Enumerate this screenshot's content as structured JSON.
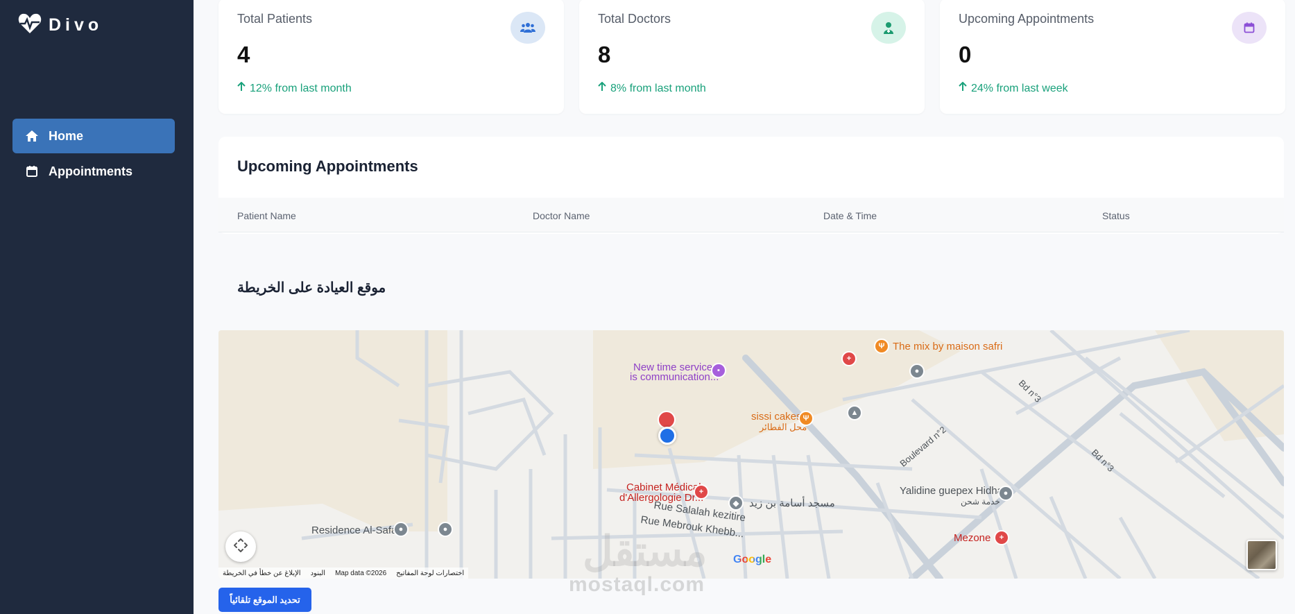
{
  "app": {
    "brand": "Divo"
  },
  "sidebar": {
    "items": [
      {
        "label": "Home",
        "icon": "home-icon",
        "active": true
      },
      {
        "label": "Appointments",
        "icon": "calendar-icon",
        "active": false
      }
    ]
  },
  "stats": [
    {
      "label": "Total Patients",
      "value": "4",
      "trend": "12% from last month",
      "icon": "users-icon",
      "badge_color": "#dbe7f6",
      "icon_color": "#2f6fd6"
    },
    {
      "label": "Total Doctors",
      "value": "8",
      "trend": "8% from last month",
      "icon": "doctor-icon",
      "badge_color": "#d6f3e8",
      "icon_color": "#1c9b70"
    },
    {
      "label": "Upcoming Appointments",
      "value": "0",
      "trend": "24% from last week",
      "icon": "calendar-icon",
      "badge_color": "#ece3f8",
      "icon_color": "#8b4fd6"
    }
  ],
  "appointments": {
    "title": "Upcoming Appointments",
    "columns": [
      "Patient Name",
      "Doctor Name",
      "Date & Time",
      "Status"
    ]
  },
  "map": {
    "title": "موقع العيادة على الخريطة",
    "places": {
      "p1": "New time services",
      "p1b": "is communication...",
      "p2": "The mix by maison safri",
      "p3": "sissi cakes",
      "p3b": "محل الفطائر",
      "p4": "Cabinet Médical",
      "p4b": "d'Allergologie Dr...",
      "p5": "مسجد أسامة بن زيد",
      "p6": "Yalidine guepex Hidhab",
      "p6b": "خدمة شحن",
      "p7": "Residence Al-Safaa",
      "p8": "Mezone",
      "r1": "Rue Salalah kezitire",
      "r2": "Rue Mebrouk Khebb...",
      "r3": "Boulevard n°2",
      "r4": "Bd n°3",
      "r5": "Bd n°3"
    },
    "attribution": [
      "اختصارات لوحة المفاتيح",
      "Map data ©2026",
      "البنود",
      "الإبلاغ عن خطأ في الخريطة"
    ],
    "google": "Google",
    "watermark": "mostaql.com",
    "watermark_ar": "مستقل"
  },
  "actions": {
    "auto_locate": "تحديد الموقع تلقائياً"
  },
  "colors": {
    "sidebar": "#1f2a3e",
    "accent": "#3a73b8",
    "button": "#2563eb",
    "trend": "#19a17b"
  }
}
